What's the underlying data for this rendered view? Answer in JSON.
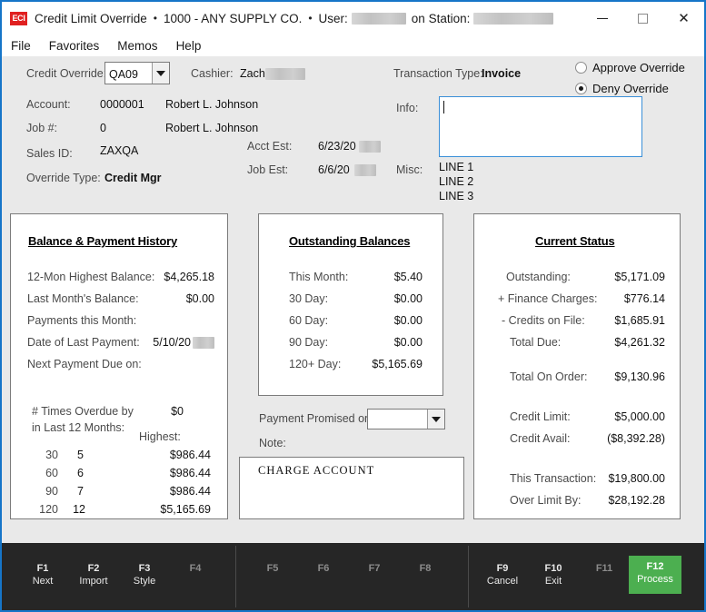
{
  "window": {
    "logo": "ECI",
    "title": "Credit Limit Override",
    "company": "1000 - ANY SUPPLY CO.",
    "user_label": "User:",
    "station_label": "on Station:",
    "sep": "•",
    "minimize_icon": "minimize-icon",
    "maximize_icon": "maximize-icon",
    "close_icon": "close-icon"
  },
  "menu": {
    "items": [
      "File",
      "Favorites",
      "Memos",
      "Help"
    ]
  },
  "form": {
    "credit_override_label": "Credit Override:",
    "credit_override_value": "QA09",
    "cashier_label": "Cashier:",
    "cashier_value": "Zach",
    "account_label": "Account:",
    "account_value": "0000001",
    "account_name": "Robert L. Johnson",
    "job_label": "Job #:",
    "job_value": "0",
    "job_name": "Robert L. Johnson",
    "sales_id_label": "Sales ID:",
    "sales_id_value": "ZAXQA",
    "override_type_label": "Override Type:",
    "override_type_value": "Credit Mgr",
    "acct_est_label": "Acct Est:",
    "acct_est_value": "6/23/20",
    "job_est_label": "Job Est:",
    "job_est_value": "6/6/20",
    "transaction_type_label": "Transaction Type:",
    "transaction_type_value": "Invoice",
    "approve_label": "Approve Override",
    "deny_label": "Deny Override",
    "approve_selected": false,
    "deny_selected": true,
    "info_label": "Info:",
    "info_value": "",
    "misc_label": "Misc:",
    "misc_lines": [
      "LINE 1",
      "LINE 2",
      "LINE 3"
    ]
  },
  "balance_panel": {
    "title": "Balance & Payment History",
    "rows": [
      {
        "label": "12-Mon Highest Balance:",
        "value": "$4,265.18"
      },
      {
        "label": "Last Month's Balance:",
        "value": "$0.00"
      },
      {
        "label": "Payments this Month:",
        "value": ""
      },
      {
        "label": "Date of Last Payment:",
        "value": "5/10/20"
      },
      {
        "label": "Next Payment Due on:",
        "value": ""
      }
    ],
    "overdue_line1": "# Times Overdue by",
    "overdue_line2": "in Last 12 Months:",
    "overdue_amount": "$0",
    "highest_header": "Highest:",
    "overdue_rows": [
      {
        "days": "30",
        "count": "5",
        "highest": "$986.44"
      },
      {
        "days": "60",
        "count": "6",
        "highest": "$986.44"
      },
      {
        "days": "90",
        "count": "7",
        "highest": "$986.44"
      },
      {
        "days": "120",
        "count": "12",
        "highest": "$5,165.69"
      }
    ]
  },
  "outstanding_panel": {
    "title": "Outstanding Balances",
    "rows": [
      {
        "label": "This Month:",
        "value": "$5.40"
      },
      {
        "label": "30 Day:",
        "value": "$0.00"
      },
      {
        "label": "60 Day:",
        "value": "$0.00"
      },
      {
        "label": "90 Day:",
        "value": "$0.00"
      },
      {
        "label": "120+ Day:",
        "value": "$5,165.69"
      }
    ]
  },
  "payment_promised": {
    "label": "Payment Promised on:",
    "value": "",
    "note_label": "Note:",
    "note_text": "CHARGE ACCOUNT"
  },
  "status_panel": {
    "title": "Current Status",
    "rows": [
      {
        "label": "Outstanding:",
        "value": "$5,171.09"
      },
      {
        "label": "+ Finance Charges:",
        "value": "$776.14"
      },
      {
        "label": "- Credits on File:",
        "value": "$1,685.91"
      },
      {
        "label": "Total Due:",
        "value": "$4,261.32"
      },
      {
        "label": "Total On Order:",
        "value": "$9,130.96"
      },
      {
        "label": "Credit Limit:",
        "value": "$5,000.00"
      },
      {
        "label": "Credit Avail:",
        "value": "($8,392.28)"
      },
      {
        "label": "This Transaction:",
        "value": "$19,800.00"
      },
      {
        "label": "Over Limit By:",
        "value": "$28,192.28"
      }
    ]
  },
  "function_bar": {
    "accent_color": "#4caf50",
    "keys": [
      {
        "num": "F1",
        "label": "Next",
        "enabled": true
      },
      {
        "num": "F2",
        "label": "Import",
        "enabled": true
      },
      {
        "num": "F3",
        "label": "Style",
        "enabled": true
      },
      {
        "num": "F4",
        "label": "",
        "enabled": false
      },
      {
        "num": "F5",
        "label": "",
        "enabled": false
      },
      {
        "num": "F6",
        "label": "",
        "enabled": false
      },
      {
        "num": "F7",
        "label": "",
        "enabled": false
      },
      {
        "num": "F8",
        "label": "",
        "enabled": false
      },
      {
        "num": "F9",
        "label": "Cancel",
        "enabled": true
      },
      {
        "num": "F10",
        "label": "Exit",
        "enabled": true
      },
      {
        "num": "F11",
        "label": "",
        "enabled": false
      },
      {
        "num": "F12",
        "label": "Process",
        "enabled": true
      }
    ]
  }
}
